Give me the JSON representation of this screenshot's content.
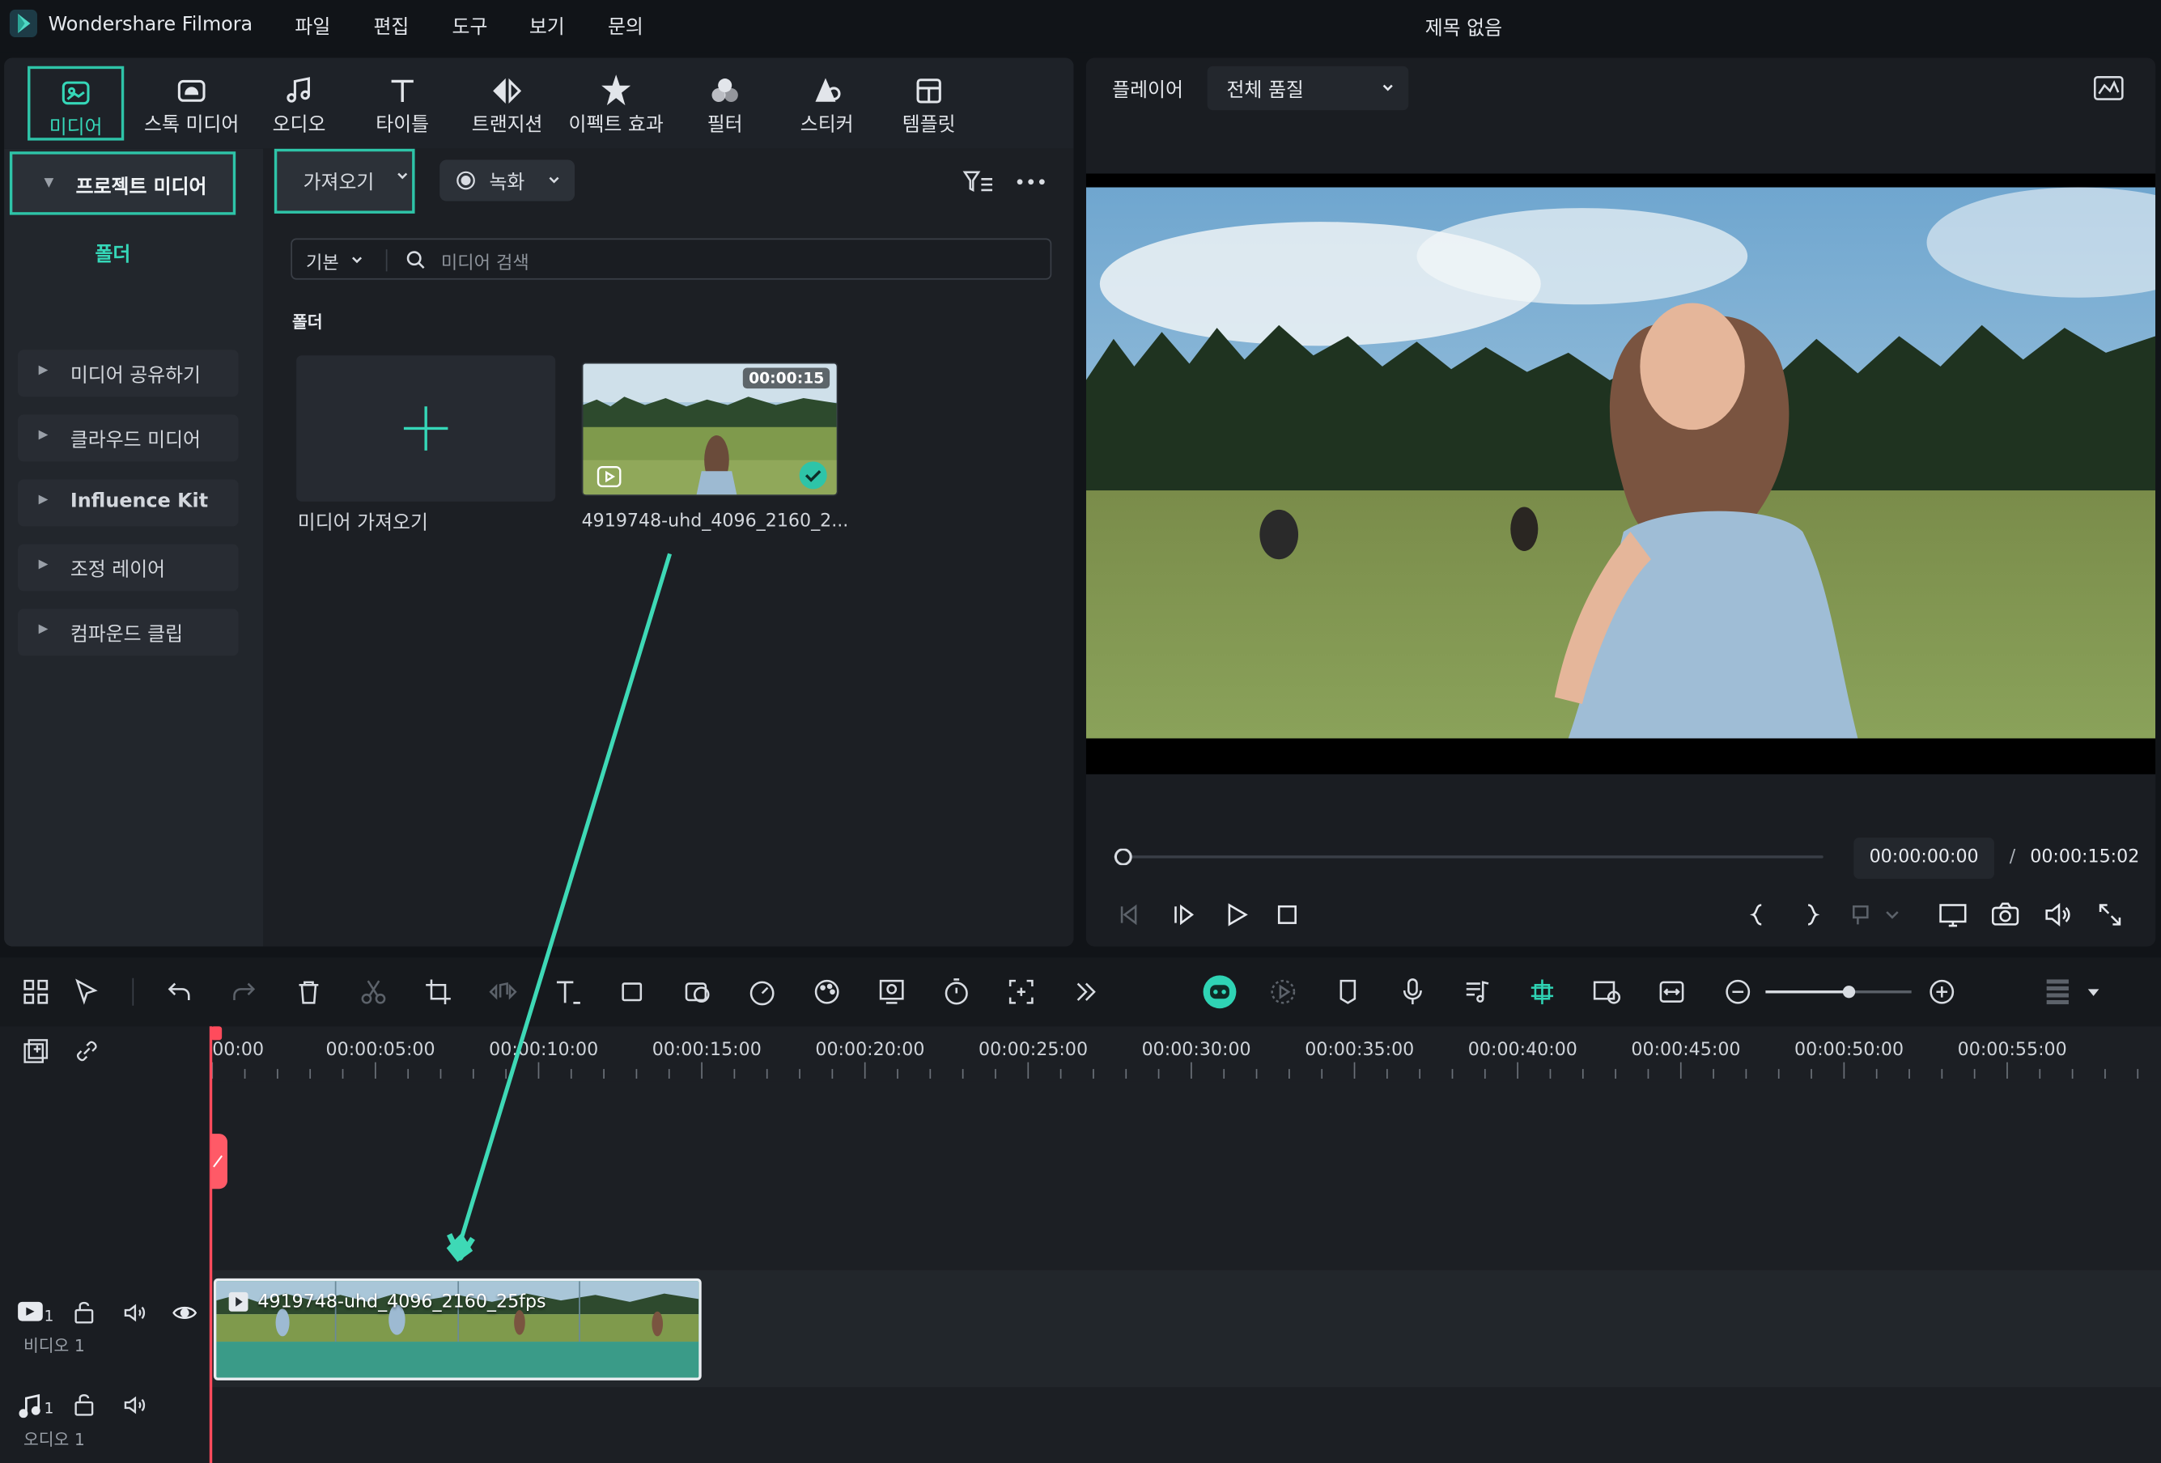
{
  "app": {
    "name": "Wondershare Filmora",
    "doc_title": "제목 없음"
  },
  "menu": [
    "파일",
    "편집",
    "도구",
    "보기",
    "문의"
  ],
  "top_tabs": [
    {
      "label": "미디어",
      "icon": "media-icon",
      "active": true
    },
    {
      "label": "스톡 미디어",
      "icon": "stock-media-icon"
    },
    {
      "label": "오디오",
      "icon": "audio-note-icon"
    },
    {
      "label": "타이틀",
      "icon": "title-t-icon"
    },
    {
      "label": "트랜지션",
      "icon": "transition-icon"
    },
    {
      "label": "이펙트 효과",
      "icon": "effects-icon"
    },
    {
      "label": "필터",
      "icon": "filter-icon"
    },
    {
      "label": "스티커",
      "icon": "sticker-icon"
    },
    {
      "label": "템플릿",
      "icon": "template-icon"
    }
  ],
  "sidebar": {
    "project_media": "프로젝트 미디어",
    "folder": "폴더",
    "items": [
      "미디어 공유하기",
      "클라우드 미디어",
      "Influence Kit",
      "조정 레이어",
      "컴파운드 클립"
    ]
  },
  "library": {
    "import_label": "가져오기",
    "record_label": "녹화",
    "sort_label": "기본",
    "search_placeholder": "미디어 검색",
    "folder_heading": "폴더",
    "import_tile_label": "미디어 가져오기",
    "clip": {
      "name": "4919748-uhd_4096_2160_2...",
      "duration": "00:00:15",
      "selected": true
    }
  },
  "player": {
    "label": "플레이어",
    "quality": "전체 품질",
    "current_time": "00:00:00:00",
    "separator": "/",
    "total_time": "00:00:15:02",
    "progress": 0
  },
  "timeline": {
    "ruler_labels": [
      "00:00",
      "00:00:05:00",
      "00:00:10:00",
      "00:00:15:00",
      "00:00:20:00",
      "00:00:25:00",
      "00:00:30:00",
      "00:00:35:00",
      "00:00:40:00",
      "00:00:45:00",
      "00:00:50:00",
      "00:00:55:00"
    ],
    "tracks": [
      {
        "label": "비디오 1",
        "number": "1",
        "type": "video"
      },
      {
        "label": "오디오 1",
        "number": "1",
        "type": "audio"
      }
    ],
    "video_clip_title": "4919748-uhd_4096_2160_25fps",
    "zoom_level": 0.6
  },
  "colors": {
    "accent": "#2ec4a8",
    "playhead": "#ff4b5c",
    "clip": "#3a9b88"
  }
}
